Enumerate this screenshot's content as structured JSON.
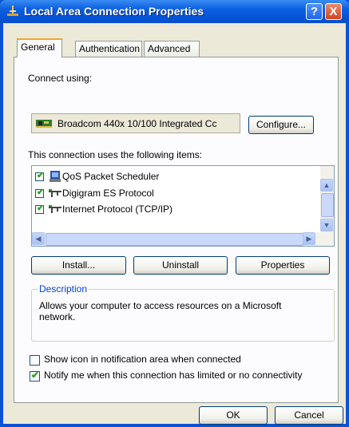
{
  "window": {
    "title": "Local Area Connection Properties",
    "help_button": "?",
    "close_button": "X"
  },
  "tabs": [
    "General",
    "Authentication",
    "Advanced"
  ],
  "general": {
    "connect_using_label": "Connect using:",
    "adapter_name": "Broadcom 440x 10/100 Integrated Cc",
    "configure_button": "Configure...",
    "items_label": "This connection uses the following items:",
    "items": [
      {
        "label": "QoS Packet Scheduler",
        "checked": true,
        "icon": "scheduler-icon"
      },
      {
        "label": "Digigram ES Protocol",
        "checked": true,
        "icon": "protocol-icon"
      },
      {
        "label": "Internet Protocol (TCP/IP)",
        "checked": true,
        "icon": "protocol-icon"
      }
    ],
    "install_button": "Install...",
    "uninstall_button": "Uninstall",
    "properties_button": "Properties",
    "description_title": "Description",
    "description_text": "Allows your computer to access resources on a Microsoft network.",
    "show_icon_label": "Show icon in notification area when connected",
    "show_icon_checked": false,
    "notify_label": "Notify me when this connection has limited or no connectivity",
    "notify_checked": true
  },
  "footer": {
    "ok_button": "OK",
    "cancel_button": "Cancel"
  },
  "colors": {
    "title_bar": "#0a5fe0",
    "dialog_bg": "#ece9d8",
    "active_tab_accent": "#f5a623",
    "group_title": "#0046d5"
  }
}
